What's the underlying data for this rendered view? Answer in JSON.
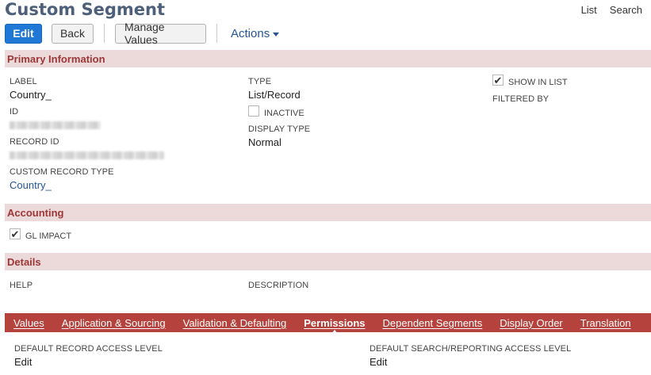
{
  "page": {
    "title": "Custom Segment",
    "top_links": {
      "list": "List",
      "search": "Search"
    }
  },
  "toolbar": {
    "edit": "Edit",
    "back": "Back",
    "manage_values": "Manage Values",
    "actions": "Actions"
  },
  "sections": {
    "primary": "Primary Information",
    "accounting": "Accounting",
    "details": "Details"
  },
  "primary": {
    "label_label": "LABEL",
    "label_value": "Country_",
    "id_label": "ID",
    "record_id_label": "RECORD ID",
    "custom_record_type_label": "CUSTOM RECORD TYPE",
    "custom_record_type_value": "Country_",
    "type_label": "TYPE",
    "type_value": "List/Record",
    "inactive_label": "INACTIVE",
    "inactive_checked": false,
    "display_type_label": "DISPLAY TYPE",
    "display_type_value": "Normal",
    "show_in_list_label": "SHOW IN LIST",
    "show_in_list_checked": true,
    "filtered_by_label": "FILTERED BY"
  },
  "accounting": {
    "gl_impact_label": "GL IMPACT",
    "gl_impact_checked": true
  },
  "details": {
    "help_label": "HELP",
    "description_label": "DESCRIPTION"
  },
  "tabs": [
    {
      "label": "Values",
      "active": false
    },
    {
      "label": "Application & Sourcing",
      "active": false
    },
    {
      "label": "Validation & Defaulting",
      "active": false
    },
    {
      "label": "Permissions",
      "active": true
    },
    {
      "label": "Dependent Segments",
      "active": false
    },
    {
      "label": "Display Order",
      "active": false
    },
    {
      "label": "Translation",
      "active": false
    }
  ],
  "permissions": {
    "default_record_access_label": "DEFAULT RECORD ACCESS LEVEL",
    "default_record_access_value": "Edit",
    "default_search_access_label": "DEFAULT SEARCH/REPORTING ACCESS LEVEL",
    "default_search_access_value": "Edit"
  },
  "colors": {
    "title": "#4d5f79",
    "primary_button": "#1f78d5",
    "section_header_bg": "#ecd9d9",
    "section_header_text": "#9b3737",
    "tab_bar": "#b5423c",
    "link": "#255599"
  }
}
